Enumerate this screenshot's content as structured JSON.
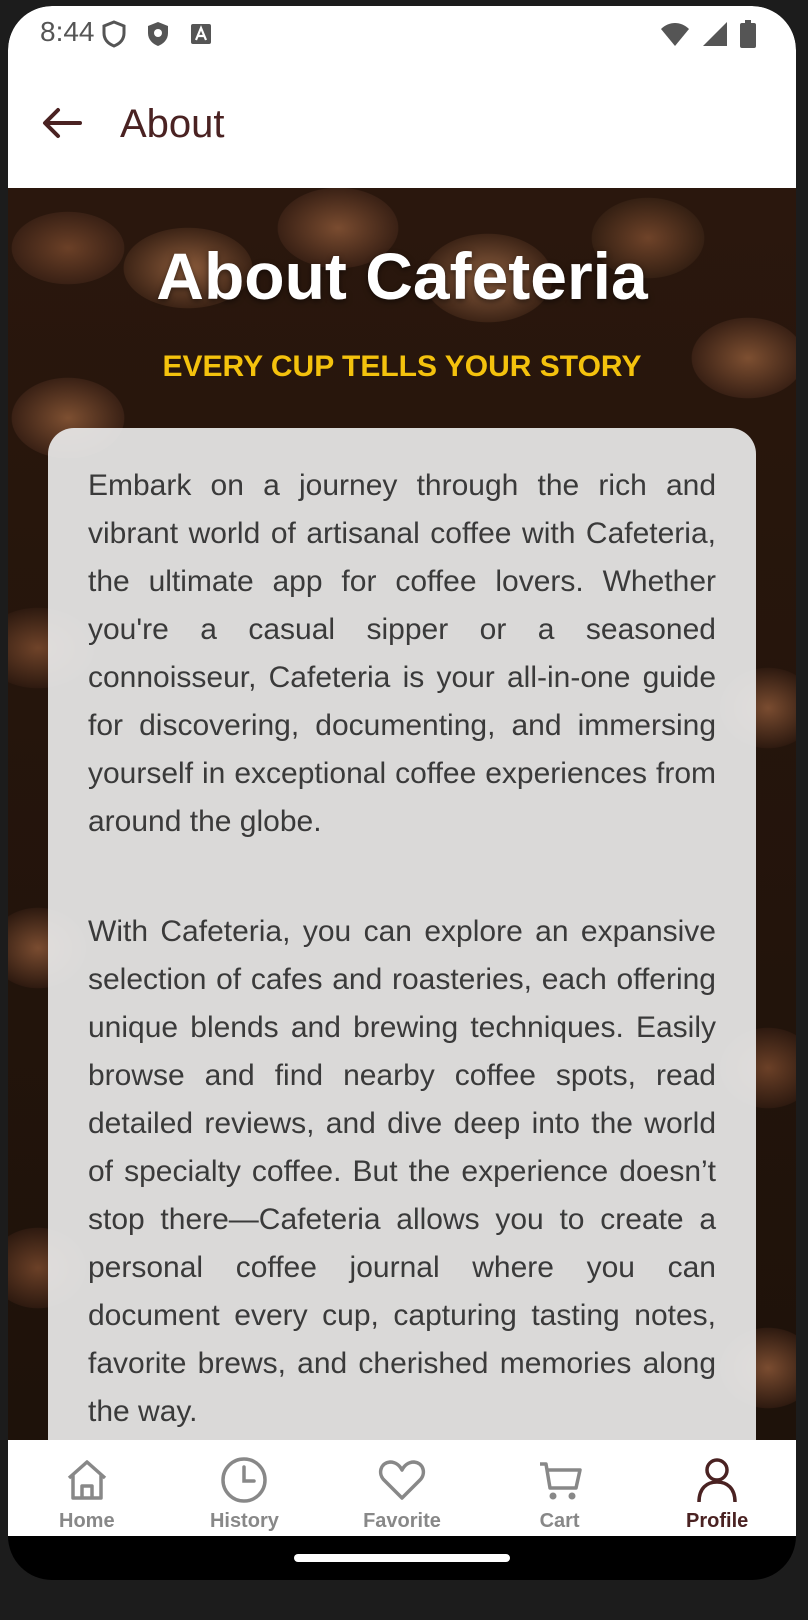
{
  "status_bar": {
    "time": "8:44",
    "left_icons": [
      "shield-icon",
      "shield-filled-icon",
      "a-icon"
    ],
    "right_icons": [
      "wifi-icon",
      "signal-icon",
      "battery-icon"
    ]
  },
  "appbar": {
    "title": "About",
    "back_icon": "arrow-left-icon"
  },
  "hero": {
    "title": "About Cafeteria",
    "subtitle": "EVERY CUP TELLS YOUR STORY"
  },
  "content": {
    "paragraphs": [
      "Embark on a journey through the rich and vibrant world of artisanal coffee with Cafeteria, the ultimate app for coffee lovers. Whether you're a casual sipper or a seasoned connoisseur, Cafeteria is your all-in-one guide for discovering, documenting, and immersing yourself in exceptional coffee experiences from around the globe.",
      "With Cafeteria, you can explore an expansive selection of cafes and roasteries, each offering unique blends and brewing techniques. Easily browse and find nearby coffee spots, read detailed reviews, and dive deep into the world of specialty coffee. But the experience doesn’t stop there—Cafeteria allows you to create a personal coffee journal where you can document every cup, capturing tasting notes, favorite brews, and cherished memories along the way."
    ]
  },
  "bottom_nav": {
    "items": [
      {
        "label": "Home",
        "icon": "home-icon"
      },
      {
        "label": "History",
        "icon": "clock-icon"
      },
      {
        "label": "Favorite",
        "icon": "heart-icon"
      },
      {
        "label": "Cart",
        "icon": "cart-icon"
      },
      {
        "label": "Profile",
        "icon": "person-icon"
      }
    ],
    "active": "Profile"
  },
  "colors": {
    "brand": "#4a2222",
    "accent": "#f4c20d",
    "inactive": "#888888"
  }
}
